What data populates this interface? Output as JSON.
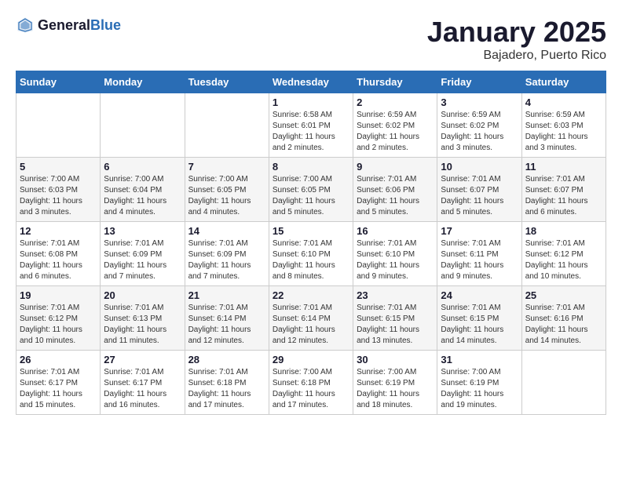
{
  "header": {
    "logo_general": "General",
    "logo_blue": "Blue",
    "month": "January 2025",
    "location": "Bajadero, Puerto Rico"
  },
  "weekdays": [
    "Sunday",
    "Monday",
    "Tuesday",
    "Wednesday",
    "Thursday",
    "Friday",
    "Saturday"
  ],
  "weeks": [
    [
      {
        "day": "",
        "info": ""
      },
      {
        "day": "",
        "info": ""
      },
      {
        "day": "",
        "info": ""
      },
      {
        "day": "1",
        "info": "Sunrise: 6:58 AM\nSunset: 6:01 PM\nDaylight: 11 hours and 2 minutes."
      },
      {
        "day": "2",
        "info": "Sunrise: 6:59 AM\nSunset: 6:02 PM\nDaylight: 11 hours and 2 minutes."
      },
      {
        "day": "3",
        "info": "Sunrise: 6:59 AM\nSunset: 6:02 PM\nDaylight: 11 hours and 3 minutes."
      },
      {
        "day": "4",
        "info": "Sunrise: 6:59 AM\nSunset: 6:03 PM\nDaylight: 11 hours and 3 minutes."
      }
    ],
    [
      {
        "day": "5",
        "info": "Sunrise: 7:00 AM\nSunset: 6:03 PM\nDaylight: 11 hours and 3 minutes."
      },
      {
        "day": "6",
        "info": "Sunrise: 7:00 AM\nSunset: 6:04 PM\nDaylight: 11 hours and 4 minutes."
      },
      {
        "day": "7",
        "info": "Sunrise: 7:00 AM\nSunset: 6:05 PM\nDaylight: 11 hours and 4 minutes."
      },
      {
        "day": "8",
        "info": "Sunrise: 7:00 AM\nSunset: 6:05 PM\nDaylight: 11 hours and 5 minutes."
      },
      {
        "day": "9",
        "info": "Sunrise: 7:01 AM\nSunset: 6:06 PM\nDaylight: 11 hours and 5 minutes."
      },
      {
        "day": "10",
        "info": "Sunrise: 7:01 AM\nSunset: 6:07 PM\nDaylight: 11 hours and 5 minutes."
      },
      {
        "day": "11",
        "info": "Sunrise: 7:01 AM\nSunset: 6:07 PM\nDaylight: 11 hours and 6 minutes."
      }
    ],
    [
      {
        "day": "12",
        "info": "Sunrise: 7:01 AM\nSunset: 6:08 PM\nDaylight: 11 hours and 6 minutes."
      },
      {
        "day": "13",
        "info": "Sunrise: 7:01 AM\nSunset: 6:09 PM\nDaylight: 11 hours and 7 minutes."
      },
      {
        "day": "14",
        "info": "Sunrise: 7:01 AM\nSunset: 6:09 PM\nDaylight: 11 hours and 7 minutes."
      },
      {
        "day": "15",
        "info": "Sunrise: 7:01 AM\nSunset: 6:10 PM\nDaylight: 11 hours and 8 minutes."
      },
      {
        "day": "16",
        "info": "Sunrise: 7:01 AM\nSunset: 6:10 PM\nDaylight: 11 hours and 9 minutes."
      },
      {
        "day": "17",
        "info": "Sunrise: 7:01 AM\nSunset: 6:11 PM\nDaylight: 11 hours and 9 minutes."
      },
      {
        "day": "18",
        "info": "Sunrise: 7:01 AM\nSunset: 6:12 PM\nDaylight: 11 hours and 10 minutes."
      }
    ],
    [
      {
        "day": "19",
        "info": "Sunrise: 7:01 AM\nSunset: 6:12 PM\nDaylight: 11 hours and 10 minutes."
      },
      {
        "day": "20",
        "info": "Sunrise: 7:01 AM\nSunset: 6:13 PM\nDaylight: 11 hours and 11 minutes."
      },
      {
        "day": "21",
        "info": "Sunrise: 7:01 AM\nSunset: 6:14 PM\nDaylight: 11 hours and 12 minutes."
      },
      {
        "day": "22",
        "info": "Sunrise: 7:01 AM\nSunset: 6:14 PM\nDaylight: 11 hours and 12 minutes."
      },
      {
        "day": "23",
        "info": "Sunrise: 7:01 AM\nSunset: 6:15 PM\nDaylight: 11 hours and 13 minutes."
      },
      {
        "day": "24",
        "info": "Sunrise: 7:01 AM\nSunset: 6:15 PM\nDaylight: 11 hours and 14 minutes."
      },
      {
        "day": "25",
        "info": "Sunrise: 7:01 AM\nSunset: 6:16 PM\nDaylight: 11 hours and 14 minutes."
      }
    ],
    [
      {
        "day": "26",
        "info": "Sunrise: 7:01 AM\nSunset: 6:17 PM\nDaylight: 11 hours and 15 minutes."
      },
      {
        "day": "27",
        "info": "Sunrise: 7:01 AM\nSunset: 6:17 PM\nDaylight: 11 hours and 16 minutes."
      },
      {
        "day": "28",
        "info": "Sunrise: 7:01 AM\nSunset: 6:18 PM\nDaylight: 11 hours and 17 minutes."
      },
      {
        "day": "29",
        "info": "Sunrise: 7:00 AM\nSunset: 6:18 PM\nDaylight: 11 hours and 17 minutes."
      },
      {
        "day": "30",
        "info": "Sunrise: 7:00 AM\nSunset: 6:19 PM\nDaylight: 11 hours and 18 minutes."
      },
      {
        "day": "31",
        "info": "Sunrise: 7:00 AM\nSunset: 6:19 PM\nDaylight: 11 hours and 19 minutes."
      },
      {
        "day": "",
        "info": ""
      }
    ]
  ]
}
